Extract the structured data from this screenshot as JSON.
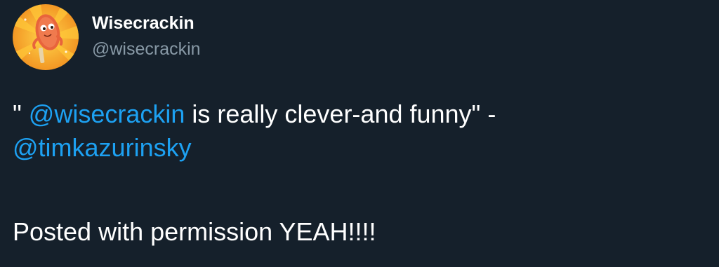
{
  "author": {
    "display_name": "Wisecrackin",
    "handle": "@wisecrackin",
    "avatar_icon": "cartoon-corn-dog-avatar"
  },
  "tweet": {
    "line1": {
      "prefix": "\" ",
      "mention": "@wisecrackin",
      "suffix": " is really clever-and funny\" -"
    },
    "line2": {
      "mention": "@timkazurinsky"
    },
    "line3": {
      "text": "Posted with permission YEAH!!!!"
    }
  },
  "colors": {
    "background": "#15202b",
    "text": "#ffffff",
    "secondary_text": "#8899a6",
    "link": "#1da1f2",
    "avatar_bg": "#f5a623"
  }
}
